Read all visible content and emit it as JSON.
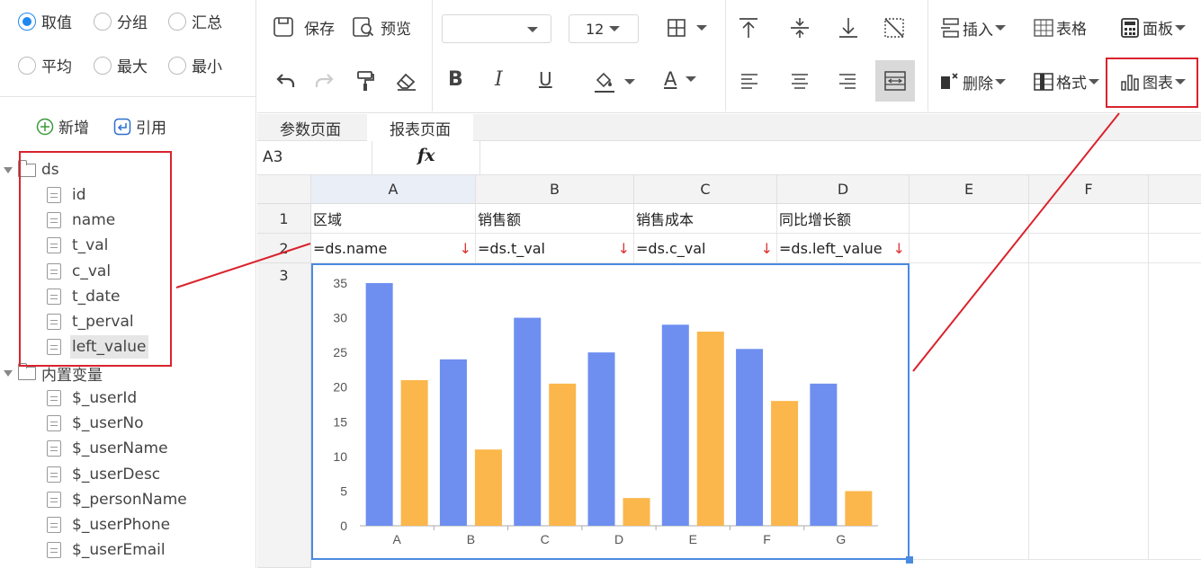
{
  "left_panel": {
    "radios": [
      {
        "label": "取值",
        "checked": true
      },
      {
        "label": "分组",
        "checked": false
      },
      {
        "label": "汇总",
        "checked": false
      },
      {
        "label": "平均",
        "checked": false
      },
      {
        "label": "最大",
        "checked": false
      },
      {
        "label": "最小",
        "checked": false
      }
    ],
    "add_label": "新增",
    "ref_label": "引用",
    "tree": {
      "ds": {
        "label": "ds",
        "fields": [
          "id",
          "name",
          "t_val",
          "c_val",
          "t_date",
          "t_perval",
          "left_value"
        ]
      },
      "builtin": {
        "label": "内置变量",
        "fields": [
          "$_userId",
          "$_userNo",
          "$_userName",
          "$_userDesc",
          "$_personName",
          "$_userPhone",
          "$_userEmail"
        ]
      }
    }
  },
  "toolbar": {
    "save": "保存",
    "preview": "预览",
    "font_size": "12",
    "insert": "插入",
    "table": "表格",
    "panel": "面板",
    "delete": "删除",
    "format": "格式",
    "chart": "图表",
    "bold": "B",
    "italic": "I",
    "underline": "U",
    "font_color": "A"
  },
  "tabs": [
    "参数页面",
    "报表页面"
  ],
  "formula_bar": {
    "cell_ref": "A3",
    "fx": "fx"
  },
  "grid": {
    "columns": [
      "A",
      "B",
      "C",
      "D",
      "E",
      "F"
    ],
    "rows": [
      "1",
      "2",
      "3"
    ],
    "row1": [
      "区域",
      "销售额",
      "销售成本",
      "同比增长额"
    ],
    "row2": [
      "=ds.name",
      "=ds.t_val",
      "=ds.c_val",
      "=ds.left_value"
    ],
    "expand_arrow": "↓"
  },
  "colors": {
    "series1": "#6e8ff0",
    "series2": "#fbb74b",
    "accent": "#1e87f0",
    "annotation": "#d9232d"
  },
  "chart_data": {
    "type": "bar",
    "categories": [
      "A",
      "B",
      "C",
      "D",
      "E",
      "F",
      "G"
    ],
    "series": [
      {
        "values": [
          35,
          24,
          30,
          25,
          29,
          25.5,
          20.5
        ]
      },
      {
        "values": [
          21,
          11,
          20.5,
          4,
          28,
          18,
          5
        ]
      }
    ],
    "ylim": [
      0,
      35
    ],
    "yticks": [
      0,
      5,
      10,
      15,
      20,
      25,
      30,
      35
    ],
    "grid": false,
    "title": "",
    "xlabel": "",
    "ylabel": ""
  }
}
